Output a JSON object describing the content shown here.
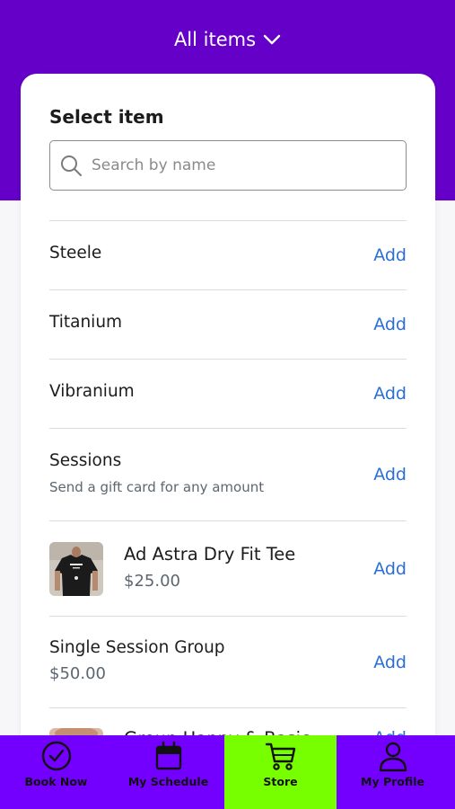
{
  "header": {
    "title": "All items"
  },
  "card": {
    "title": "Select item",
    "search_placeholder": "Search by name"
  },
  "items": [
    {
      "name": "Steele",
      "action": "Add"
    },
    {
      "name": "Titanium",
      "action": "Add"
    },
    {
      "name": "Vibranium",
      "action": "Add"
    },
    {
      "name": "Sessions",
      "subtitle": "Send a gift card for any amount",
      "action": "Add"
    },
    {
      "name": "Ad Astra Dry Fit Tee",
      "price": "$25.00",
      "action": "Add"
    },
    {
      "name": "Single Session Group",
      "price": "$50.00",
      "action": "Add"
    },
    {
      "name": "Group Happy & Basic",
      "action": "Add"
    }
  ],
  "nav": [
    {
      "label": "Book Now",
      "icon": "check-circle-icon"
    },
    {
      "label": "My Schedule",
      "icon": "calendar-icon"
    },
    {
      "label": "Store",
      "icon": "cart-icon",
      "active": true
    },
    {
      "label": "My Profile",
      "icon": "person-icon"
    }
  ],
  "colors": {
    "brand_purple": "#6500c9",
    "nav_purple": "#7300ff",
    "nav_active": "#77ff00",
    "link_blue": "#2a6fd6"
  }
}
